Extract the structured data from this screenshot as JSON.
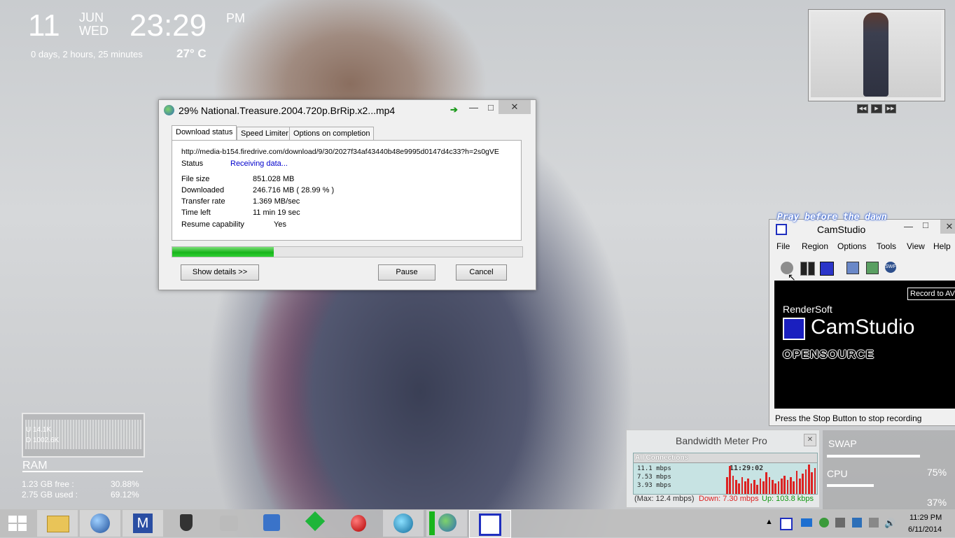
{
  "clock": {
    "day": "11",
    "month": "JUN",
    "weekday": "WED",
    "time": "23:29",
    "ampm": "PM",
    "uptime": "0 days, 2 hours, 25 minutes",
    "temperature": "27° C"
  },
  "idm": {
    "title": "29% National.Treasure.2004.720p.BrRip.x2...mp4",
    "tabs": [
      "Download status",
      "Speed Limiter",
      "Options on completion"
    ],
    "url": "http://media-b154.firedrive.com/download/9/30/2027f34af43440b48e9995d0147d4c33?h=2s0gVE",
    "status_label": "Status",
    "status_value": "Receiving data...",
    "rows": [
      {
        "label": "File size",
        "value": "851.028  MB"
      },
      {
        "label": "Downloaded",
        "value": "246.716  MB  ( 28.99 % )"
      },
      {
        "label": "Transfer rate",
        "value": "1.369  MB/sec"
      },
      {
        "label": "Time left",
        "value": "11 min 19 sec"
      },
      {
        "label": "Resume capability",
        "value": "Yes"
      }
    ],
    "progress": 0.2899,
    "show_details": "Show details >>",
    "pause": "Pause",
    "cancel": "Cancel"
  },
  "camstudio": {
    "tagline": "Pray before the dawn",
    "title": "CamStudio",
    "menu": [
      "File",
      "Region",
      "Options",
      "Tools",
      "View",
      "Help"
    ],
    "tooltip": "Record to AV",
    "brand": "RenderSoft",
    "product": "CamStudio",
    "opensource": "OPENSOURCE",
    "status": "Press the Stop Button to stop recording"
  },
  "bandwidth": {
    "title": "Bandwidth Meter Pro",
    "connections": "All Connections",
    "time": "11:29:02",
    "scale": [
      "11.1 mbps",
      "7.53 mbps",
      "3.93 mbps"
    ],
    "max": "(Max: 12.4 mbps)",
    "down": "Down: 7.30 mbps",
    "up": "Up: 103.8 kbps",
    "bars": [
      0.55,
      0.9,
      0.6,
      0.45,
      0.35,
      0.55,
      0.4,
      0.5,
      0.35,
      0.45,
      0.3,
      0.5,
      0.4,
      0.7,
      0.55,
      0.45,
      0.35,
      0.4,
      0.5,
      0.6,
      0.45,
      0.55,
      0.4,
      0.75,
      0.5,
      0.65,
      0.8,
      0.95,
      0.7,
      0.85
    ]
  },
  "network": {
    "upload": "U 14.1K",
    "download": "D 1002.6K"
  },
  "ram": {
    "title": "RAM",
    "free_label": "1.23 GB free :",
    "free_pct": "30.88%",
    "used_label": "2.75 GB used :",
    "used_pct": "69.12%"
  },
  "system": {
    "swap_label": "SWAP",
    "cpu_label": "CPU",
    "cpu_pct": "75%",
    "other_pct": "37%",
    "swap_level": 0.74,
    "cpu_level": 0.37
  },
  "tray": {
    "time": "11:29 PM",
    "date": "6/11/2014"
  },
  "colors": {
    "idm_progress": "#19b51c",
    "link_blue": "#0000cc",
    "bw_down": "#dd2222",
    "bw_up": "#119911"
  },
  "icons": [
    "windows-icon",
    "file-explorer-icon",
    "globe-icon",
    "m-app-icon",
    "shield-icon",
    "tools-icon",
    "network-icon",
    "f-app-icon",
    "apple-icon",
    "browser-icon",
    "idm-icon",
    "camstudio-icon"
  ]
}
